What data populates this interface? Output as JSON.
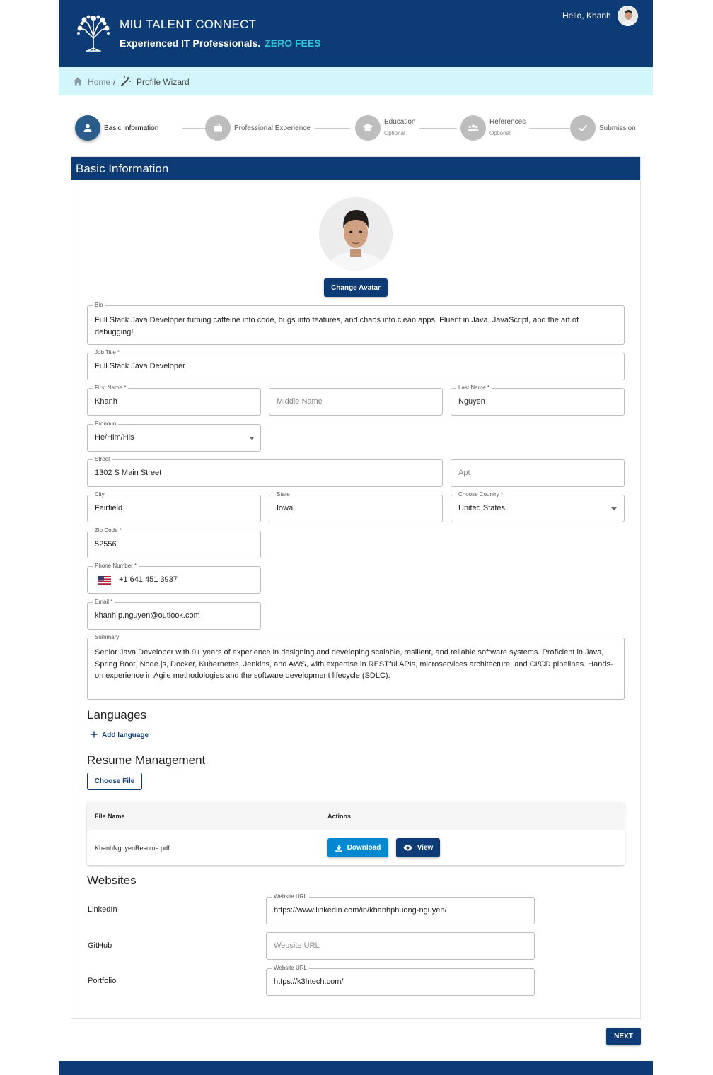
{
  "header": {
    "brand": "MIU TALENT CONNECT",
    "tagline": "Experienced IT Professionals.",
    "tagline_accent": "ZERO FEES",
    "greeting": "Hello, Khanh",
    "accent_color": "#2ec4d6",
    "bar_color": "#0c3b76"
  },
  "breadcrumb": {
    "home": "Home",
    "separator": "/",
    "current": "Profile Wizard"
  },
  "steps": [
    {
      "label": "Basic Information",
      "sub": "",
      "icon": "person-icon",
      "active": true
    },
    {
      "label": "Professional Experience",
      "sub": "",
      "icon": "briefcase-icon",
      "active": false
    },
    {
      "label": "Education",
      "sub": "Optional",
      "icon": "school-icon",
      "active": false
    },
    {
      "label": "References",
      "sub": "Optional",
      "icon": "group-icon",
      "active": false
    },
    {
      "label": "Submission",
      "sub": "",
      "icon": "check-icon",
      "active": false
    }
  ],
  "card": {
    "title": "Basic Information",
    "change_avatar": "Change Avatar"
  },
  "form": {
    "bio": {
      "label": "Bio",
      "value": "Full Stack Java Developer turning caffeine into code, bugs into features, and chaos into clean apps. Fluent in Java, JavaScript, and the art of debugging!"
    },
    "job_title": {
      "label": "Job Title *",
      "value": "Full Stack Java Developer"
    },
    "first_name": {
      "label": "First Name *",
      "value": "Khanh"
    },
    "middle_name": {
      "placeholder": "Middle Name"
    },
    "last_name": {
      "label": "Last Name *",
      "value": "Nguyen"
    },
    "pronoun": {
      "label": "Pronoun",
      "value": "He/Him/His"
    },
    "street": {
      "label": "Street",
      "value": "1302 S Main Street"
    },
    "apt": {
      "placeholder": "Apt"
    },
    "city": {
      "label": "City",
      "value": "Fairfield"
    },
    "state": {
      "label": "State",
      "value": "Iowa"
    },
    "country": {
      "label": "Choose Country *",
      "value": "United States"
    },
    "zip": {
      "label": "Zip Code *",
      "value": "52556"
    },
    "phone": {
      "label": "Phone Number *",
      "value": "+1 641 451 3937"
    },
    "email": {
      "label": "Email *",
      "value": "khanh.p.nguyen@outlook.com"
    },
    "summary": {
      "label": "Summary",
      "value": "Senior Java Developer with 9+ years of experience in designing and developing scalable, resilient, and reliable software systems. Proficient in Java, Spring Boot, Node.js, Docker, Kubernetes, Jenkins, and AWS, with expertise in RESTful APIs, microservices architecture, and CI/CD pipelines. Hands-on experience in Agile methodologies and the software development lifecycle (SDLC)."
    }
  },
  "languages": {
    "title": "Languages",
    "add": "Add language"
  },
  "resume": {
    "title": "Resume Management",
    "choose_file": "Choose File",
    "columns": [
      "File Name",
      "Actions"
    ],
    "file_name": "KhanhNguyenResume.pdf",
    "download": "Download",
    "view": "View"
  },
  "websites": {
    "title": "Websites",
    "url_label": "Website URL",
    "items": [
      {
        "name": "LinkedIn",
        "value": "https://www.linkedin.com/in/khanhphuong-nguyen/"
      },
      {
        "name": "GitHub",
        "placeholder": "Website URL"
      },
      {
        "name": "Portfolio",
        "value": "https://k3htech.com/"
      }
    ]
  },
  "next_label": "NEXT"
}
